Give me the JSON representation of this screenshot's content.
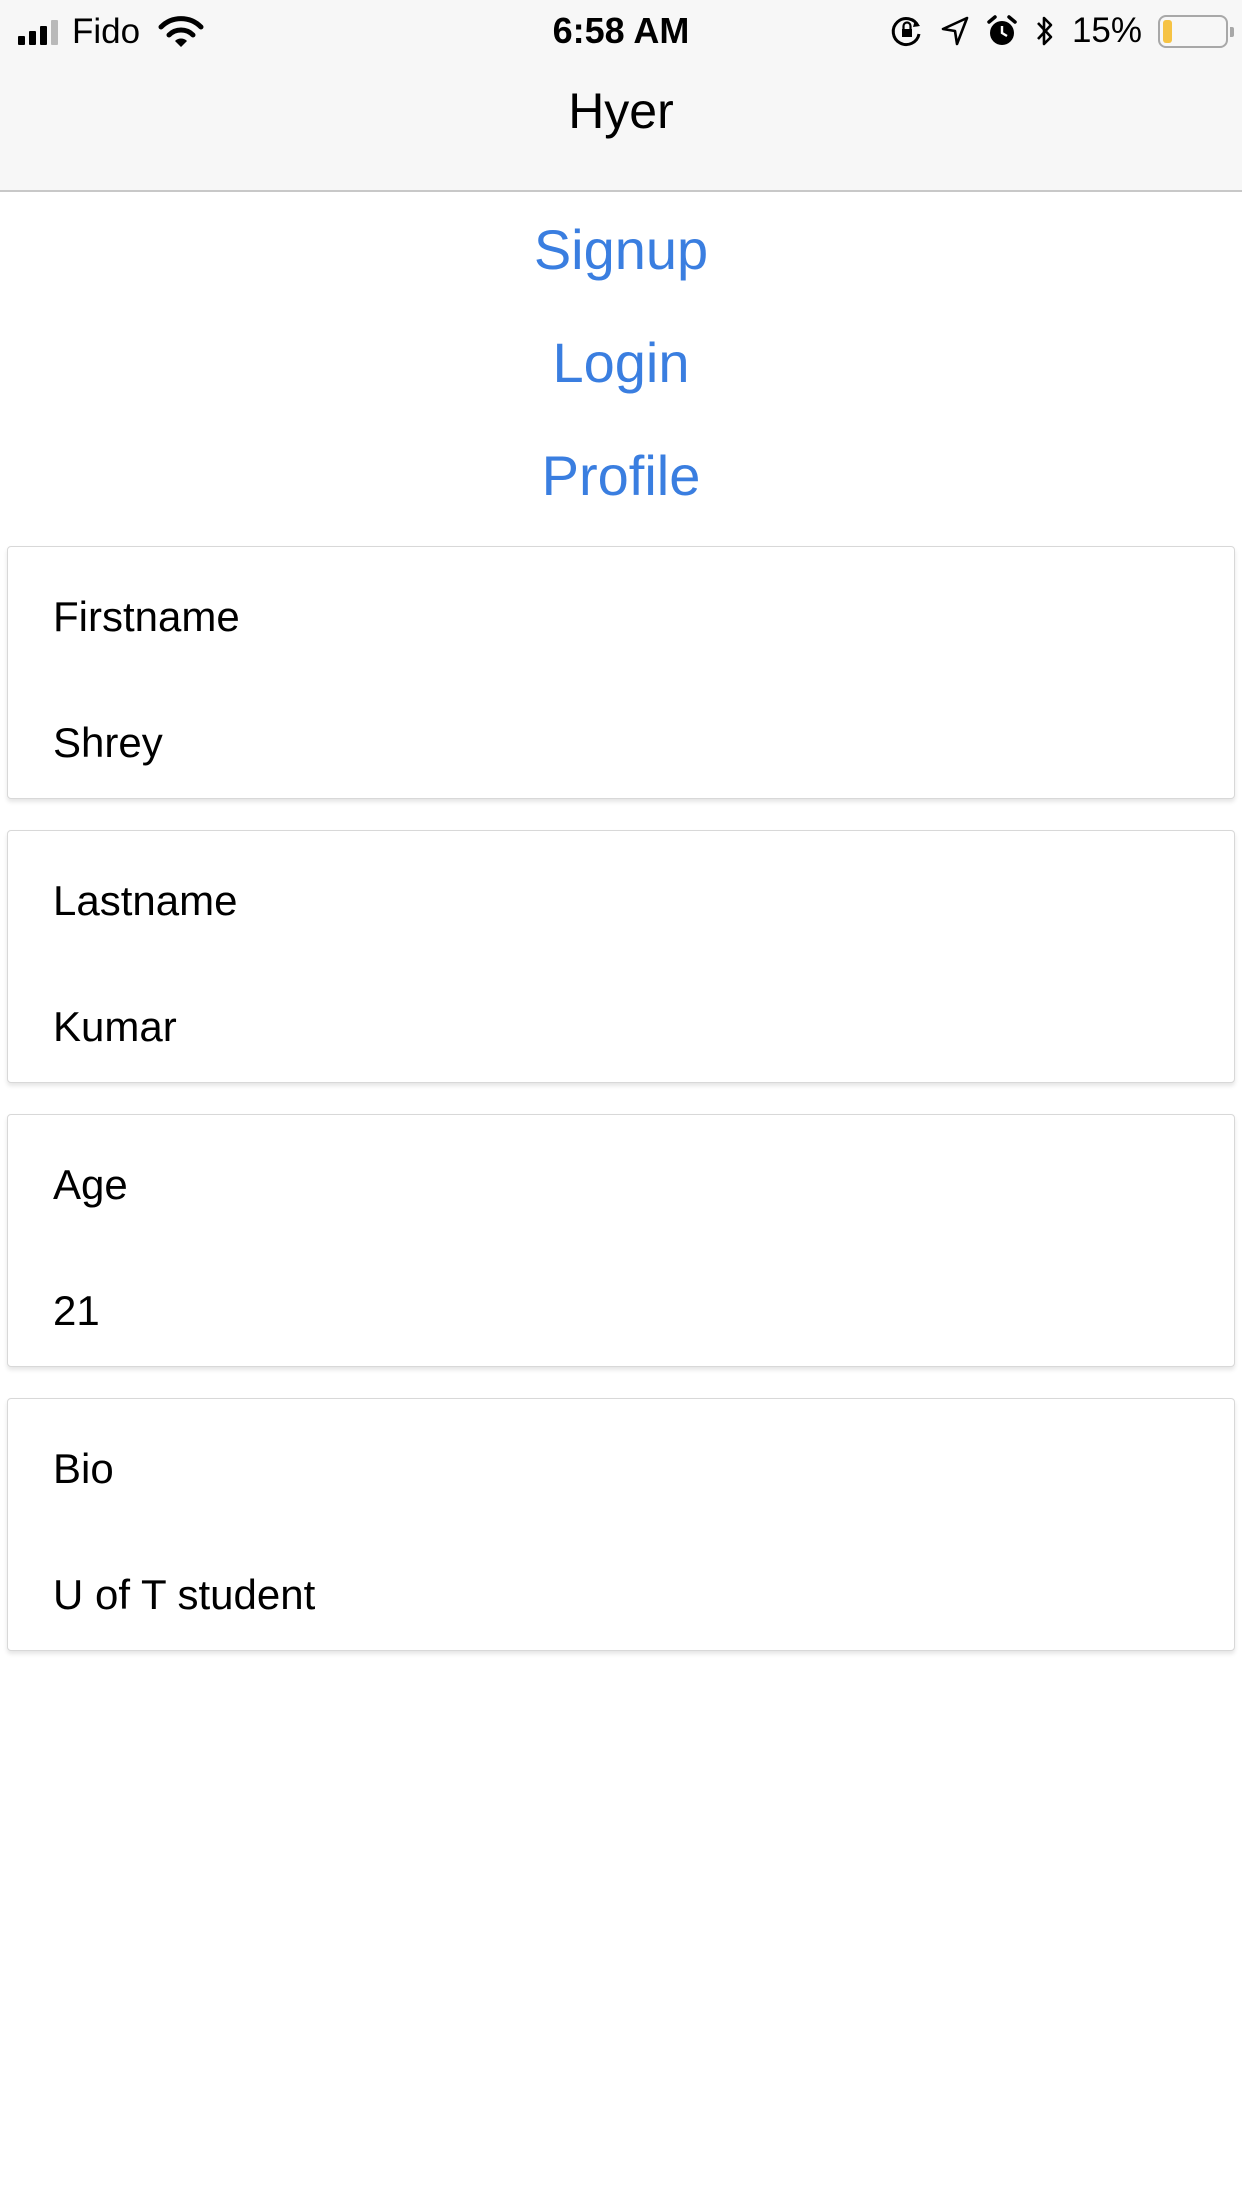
{
  "status_bar": {
    "carrier": "Fido",
    "time": "6:58 AM",
    "battery_percent": "15%",
    "battery_level": 0.15,
    "icons": [
      "signal-icon",
      "wifi-icon",
      "orientation-lock-icon",
      "location-icon",
      "alarm-icon",
      "bluetooth-icon",
      "battery-icon"
    ]
  },
  "nav": {
    "title": "Hyer"
  },
  "links": [
    {
      "label": "Signup"
    },
    {
      "label": "Login"
    },
    {
      "label": "Profile"
    }
  ],
  "profile": [
    {
      "label": "Firstname",
      "value": "Shrey"
    },
    {
      "label": "Lastname",
      "value": "Kumar"
    },
    {
      "label": "Age",
      "value": "21"
    },
    {
      "label": "Bio",
      "value": "U of T student"
    }
  ],
  "colors": {
    "link": "#3a7ee0",
    "battery_fill": "#f6c344",
    "bar_bg": "#f7f7f7"
  }
}
